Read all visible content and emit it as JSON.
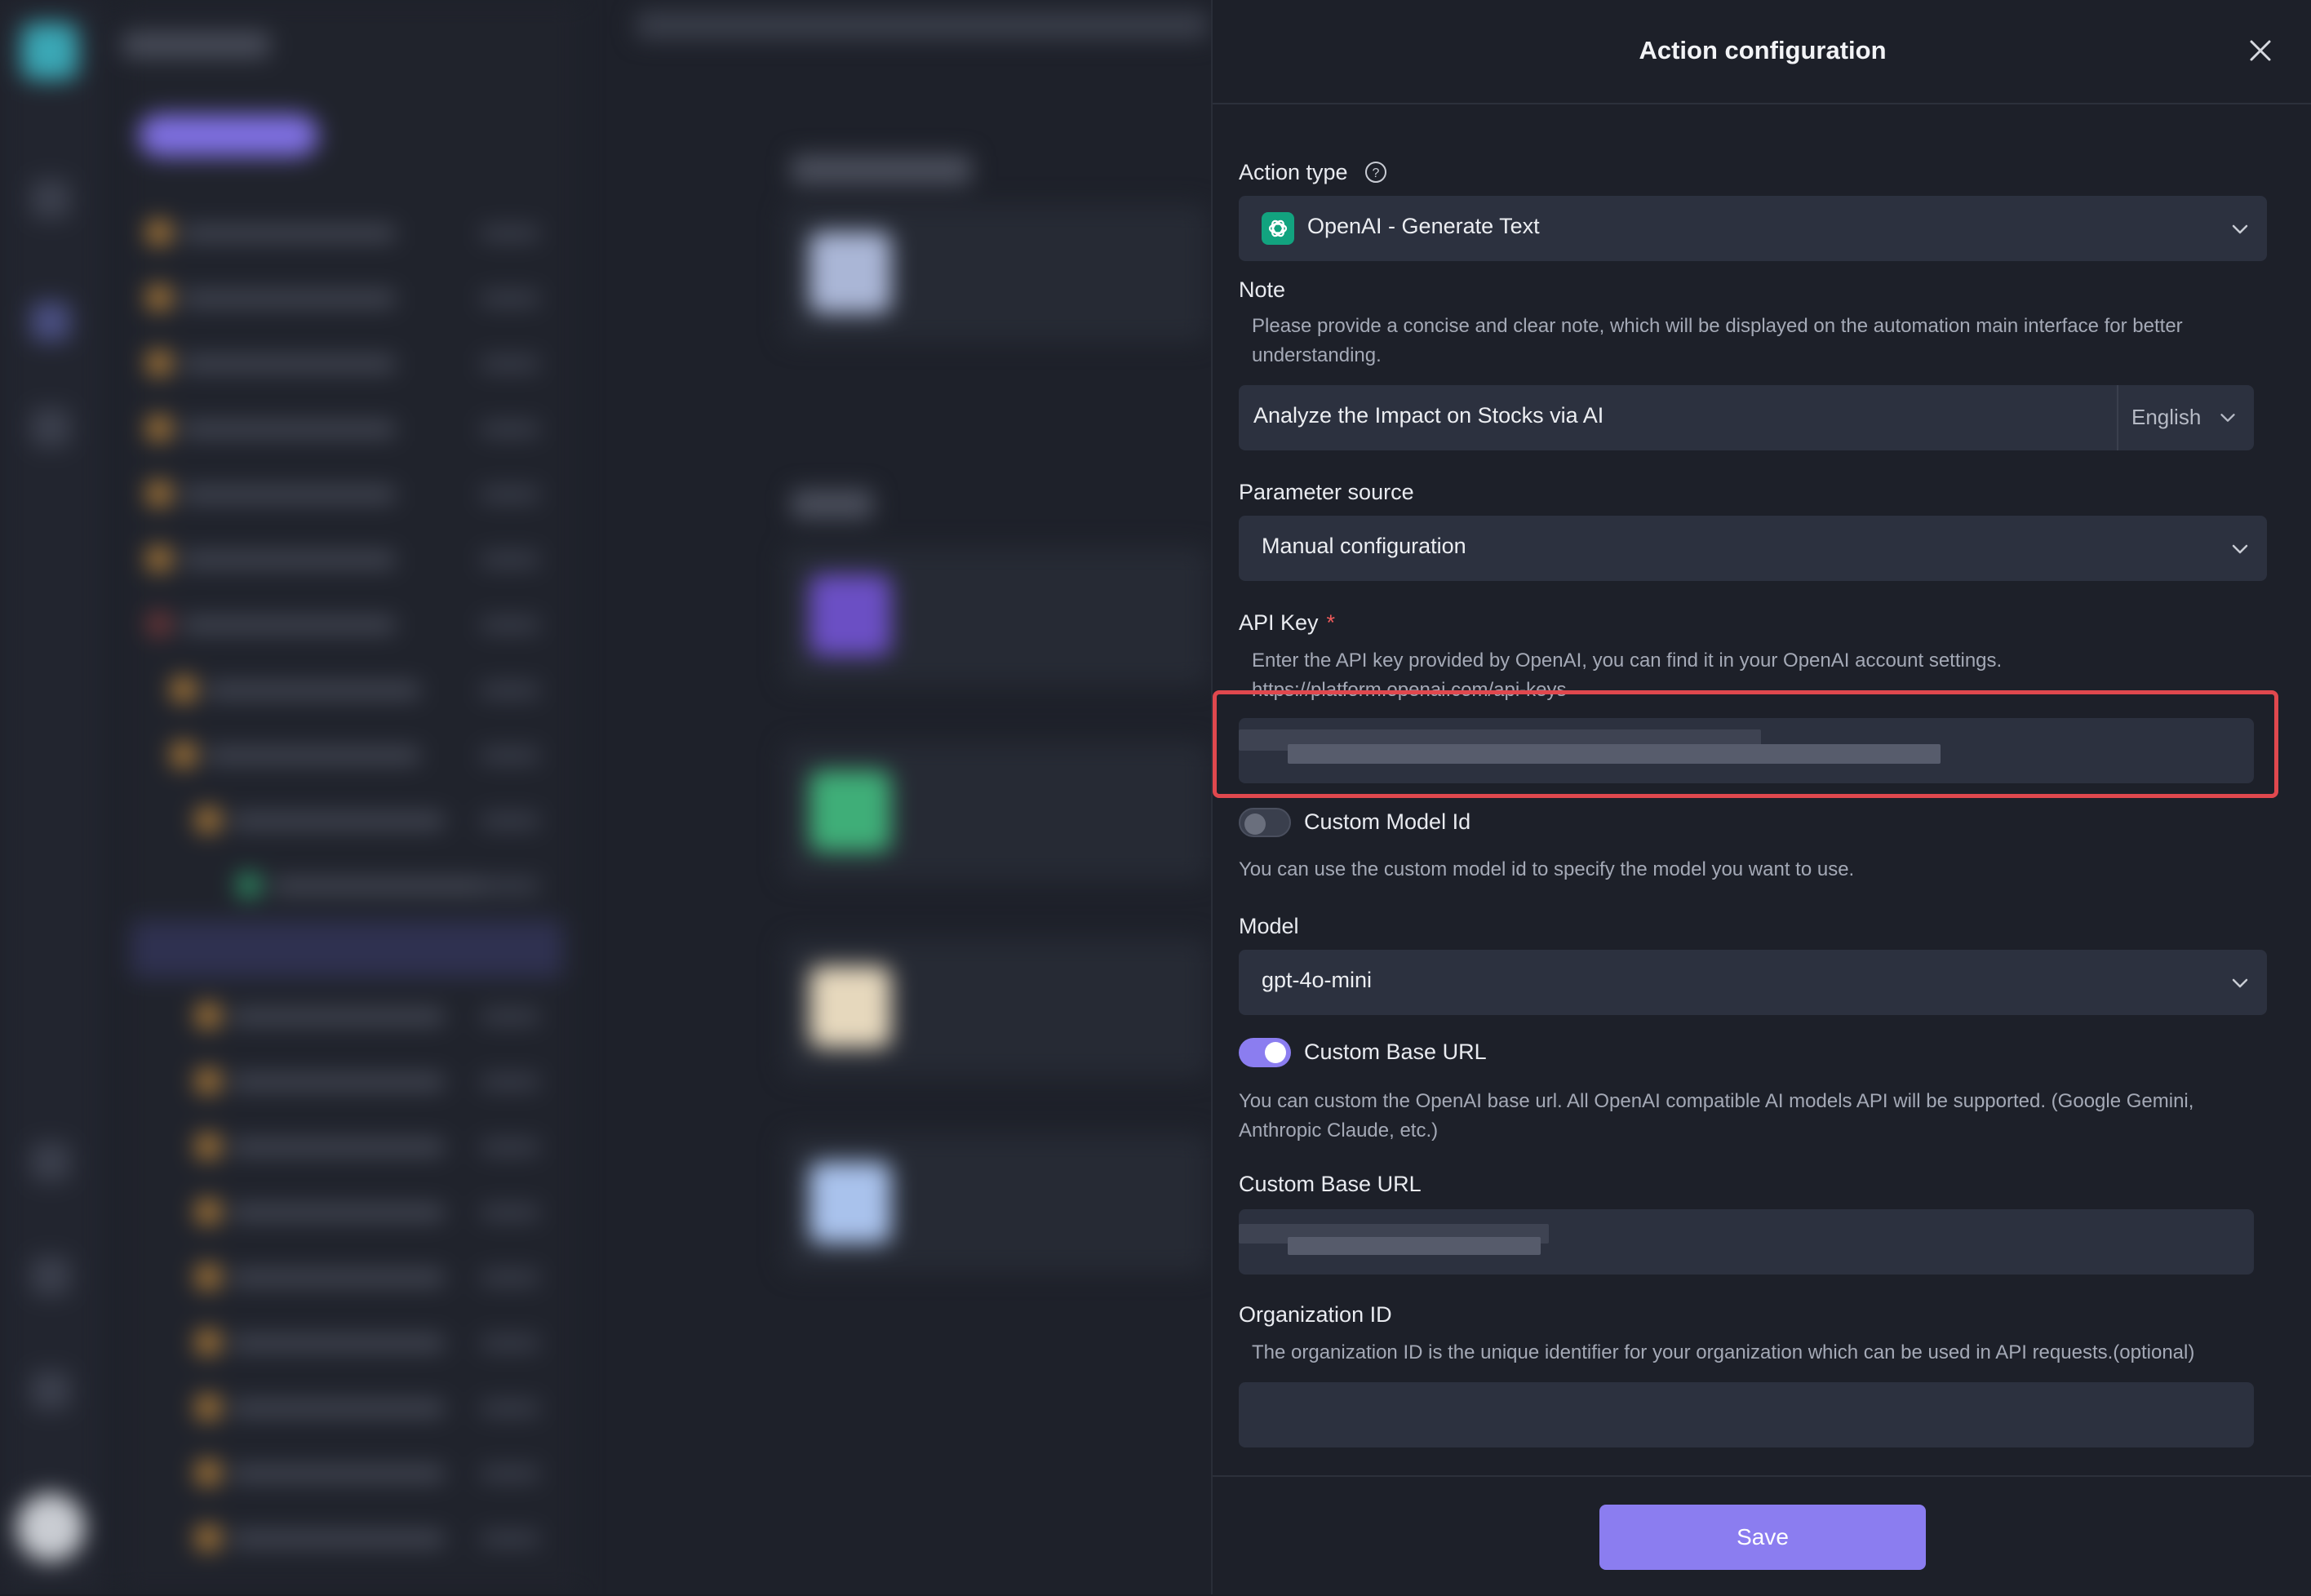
{
  "drawer": {
    "title": "Action configuration",
    "action_type": {
      "label": "Action type",
      "value": "OpenAI - Generate Text"
    },
    "note": {
      "label": "Note",
      "hint": "Please provide a concise and clear note, which will be displayed on the automation main interface for better understanding.",
      "value": "Analyze the Impact on Stocks via AI",
      "language": "English"
    },
    "parameter_source": {
      "label": "Parameter source",
      "value": "Manual configuration"
    },
    "api_key": {
      "label": "API Key",
      "required_mark": "*",
      "hint": "Enter the API key provided by OpenAI, you can find it in your OpenAI account settings.",
      "hint_link": "https://platform.openai.com/api-keys"
    },
    "custom_model_id": {
      "label": "Custom Model Id",
      "enabled": false,
      "hint": "You can use the custom model id to specify the model you want to use."
    },
    "model": {
      "label": "Model",
      "value": "gpt-4o-mini"
    },
    "custom_base_url_toggle": {
      "label": "Custom Base URL",
      "enabled": true,
      "hint": "You can custom the OpenAI base url. All OpenAI compatible AI models API will be supported. (Google Gemini, Anthropic Claude, etc.)"
    },
    "custom_base_url": {
      "label": "Custom Base URL"
    },
    "organization_id": {
      "label": "Organization ID",
      "hint": "The organization ID is the unique identifier for your organization which can be used in API requests.(optional)",
      "value": ""
    },
    "save_label": "Save"
  },
  "colors": {
    "accent": "#8b7df0",
    "highlight": "#e0484e",
    "openai_green": "#12a37f",
    "drawer_bg": "#1d2029",
    "field_bg": "#2c313f"
  }
}
